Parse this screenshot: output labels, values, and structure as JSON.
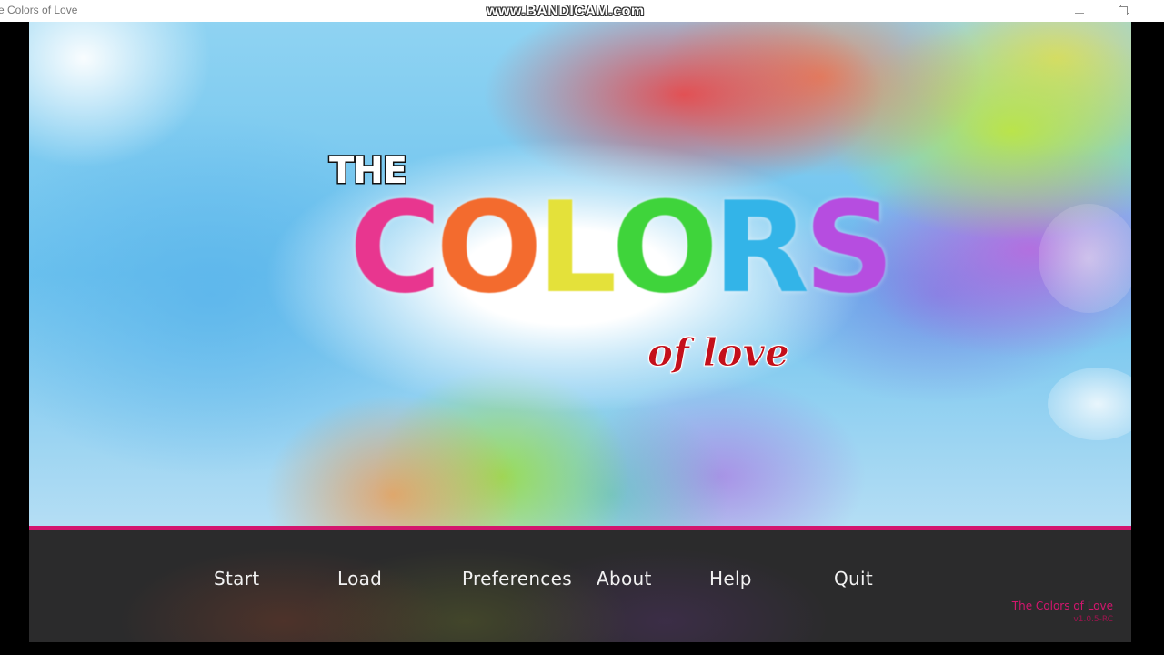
{
  "window": {
    "title": "e Colors of Love",
    "watermark": "www.BANDICAM.com"
  },
  "logo": {
    "the": "THE",
    "colors_letters": [
      {
        "char": "C",
        "color": "#e8368f"
      },
      {
        "char": "O",
        "color": "#f36b2e"
      },
      {
        "char": "L",
        "color": "#e4e13a"
      },
      {
        "char": "O",
        "color": "#3fd43b"
      },
      {
        "char": "R",
        "color": "#33b4e8"
      },
      {
        "char": "S",
        "color": "#b64de0"
      }
    ],
    "tagline": "of love"
  },
  "menu": {
    "start": "Start",
    "load": "Load",
    "preferences": "Preferences",
    "about": "About",
    "help": "Help",
    "quit": "Quit"
  },
  "footer": {
    "game_name": "The Colors of Love",
    "version": "v1.0.5-RC"
  },
  "colors": {
    "accent": "#d3166e",
    "menu_bg": "#2b2b2c",
    "tagline": "#c40f1a"
  },
  "icons": [
    "minimize-icon",
    "maximize-icon"
  ]
}
